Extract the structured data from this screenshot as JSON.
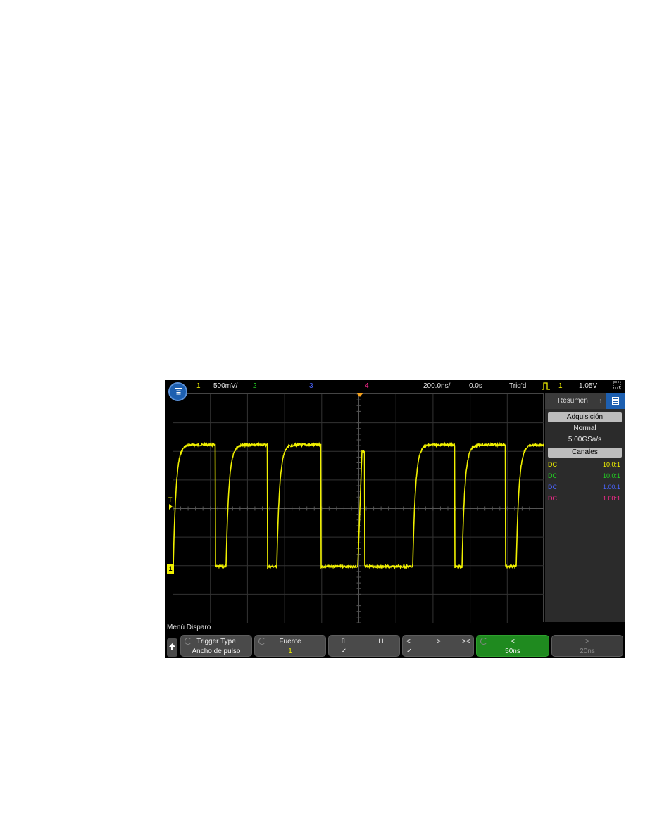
{
  "topbar": {
    "ch1_label": "1",
    "ch1_scale": "500mV/",
    "ch2_label": "2",
    "ch3_label": "3",
    "ch4_label": "4",
    "timebase": "200.0ns/",
    "delay": "0.0s",
    "trigger_status": "Trig'd",
    "trigger_type_icon": "pulse-icon",
    "trigger_source": "1",
    "trigger_level": "1.05V"
  },
  "graticule": {
    "trigger_level_marker": "T",
    "ch1_ground_marker": "1"
  },
  "sidebar": {
    "tab_label": "Resumen",
    "acquisition_header": "Adquisición",
    "acquisition_mode": "Normal",
    "sample_rate": "5.00GSa/s",
    "channels_header": "Canales",
    "channels": [
      {
        "coupling": "DC",
        "probe": "10.0:1",
        "color": "#f0f000"
      },
      {
        "coupling": "DC",
        "probe": "10.0:1",
        "color": "#22d022"
      },
      {
        "coupling": "DC",
        "probe": "1.00:1",
        "color": "#4a64ff"
      },
      {
        "coupling": "DC",
        "probe": "1.00:1",
        "color": "#ff2a90"
      }
    ]
  },
  "status": {
    "menu_title": "Menú Disparo"
  },
  "softkeys": {
    "trigger_type_title": "Trigger Type",
    "trigger_type_value": "Ancho de pulso",
    "source_title": "Fuente",
    "source_value": "1",
    "polarity_pos": "⎍",
    "polarity_neg": "⊔",
    "polarity_check": "✓",
    "qualifier_lt": "<",
    "qualifier_gt": ">",
    "qualifier_range": "><",
    "qualifier_check": "✓",
    "lt_title": "<",
    "lt_value": "50ns",
    "gt_title": ">",
    "gt_value": "20ns"
  },
  "colors": {
    "ch1": "#f0f000",
    "ch2": "#22d022",
    "ch3": "#4a64ff",
    "ch4": "#ff2a90",
    "trigger_marker": "#f7a21b",
    "active_softkey": "#1f8a1f",
    "menu_blue": "#1d5fb0"
  }
}
